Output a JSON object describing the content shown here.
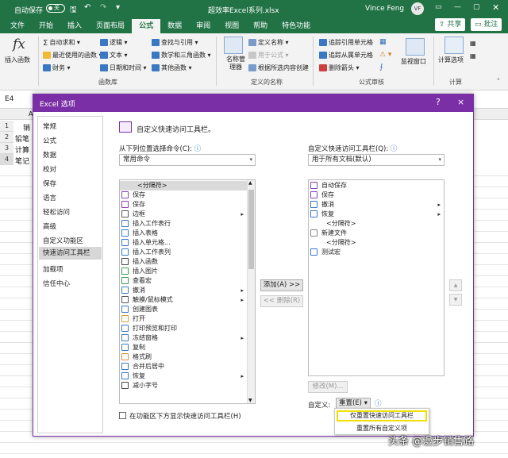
{
  "titlebar": {
    "autosave_label": "自动保存",
    "toggle_state": "关",
    "file_title": "超效率Excel系列.xlsx",
    "username": "Vince Feng",
    "user_initials": "VF"
  },
  "menu_tabs": [
    "文件",
    "开始",
    "插入",
    "页面布局",
    "公式",
    "数据",
    "审阅",
    "视图",
    "帮助",
    "特色功能"
  ],
  "share_label": "共享",
  "comment_label": "批注",
  "ribbon": {
    "insert_function": "插入函数",
    "autosum": "自动求和",
    "recent": "最近使用的函数",
    "financial": "财务",
    "logical": "逻辑",
    "text": "文本",
    "datetime": "日期和时间",
    "lookup": "查找与引用",
    "math": "数学和三角函数",
    "more": "其他函数",
    "function_library": "函数库",
    "name_manager": "名称管理器",
    "define_name": "定义名称",
    "use_in_formula": "用于公式",
    "create_from_selection": "根据所选内容创建",
    "defined_names": "定义的名称",
    "trace_precedents": "追踪引用单元格",
    "trace_dependents": "追踪从属单元格",
    "remove_arrows": "删除箭头",
    "formula_auditing": "公式审核",
    "watch_window": "监视窗口",
    "calc_options": "计算选项",
    "calculation": "计算"
  },
  "name_box": "E4",
  "sheet": {
    "rows": [
      "1",
      "2",
      "3",
      "4"
    ],
    "cells": [
      "销",
      "铅笔",
      "计算",
      "笔记"
    ],
    "col_a": "A"
  },
  "dialog": {
    "title": "Excel 选项",
    "help": "?",
    "close": "×",
    "nav": [
      "常规",
      "公式",
      "数据",
      "校对",
      "保存",
      "语言",
      "轻松访问",
      "高级",
      "自定义功能区",
      "快速访问工具栏",
      "加载项",
      "信任中心"
    ],
    "heading": "自定义快速访问工具栏。",
    "choose_label": "从下列位置选择命令(C):",
    "choose_value": "常用命令",
    "customize_label": "自定义快速访问工具栏(Q):",
    "customize_value": "用于所有文档(默认)",
    "commands": [
      {
        "label": "<分隔符>",
        "icon": "",
        "sub": false
      },
      {
        "label": "保存",
        "icon": "save",
        "sub": false
      },
      {
        "label": "保存",
        "icon": "save",
        "sub": false
      },
      {
        "label": "边框",
        "icon": "border",
        "sub": true
      },
      {
        "label": "插入工作表行",
        "icon": "insert-row",
        "sub": false
      },
      {
        "label": "插入表格",
        "icon": "table",
        "sub": false
      },
      {
        "label": "插入单元格...",
        "icon": "cell",
        "sub": false
      },
      {
        "label": "插入工作表列",
        "icon": "insert-col",
        "sub": false
      },
      {
        "label": "插入函数",
        "icon": "fx",
        "sub": false
      },
      {
        "label": "插入图片",
        "icon": "picture",
        "sub": false
      },
      {
        "label": "查看宏",
        "icon": "macro",
        "sub": false
      },
      {
        "label": "撤消",
        "icon": "undo",
        "sub": true
      },
      {
        "label": "触摸/鼠标模式",
        "icon": "touch",
        "sub": true
      },
      {
        "label": "创建图表",
        "icon": "chart",
        "sub": false
      },
      {
        "label": "打开",
        "icon": "open",
        "sub": false
      },
      {
        "label": "打印预览和打印",
        "icon": "print",
        "sub": false
      },
      {
        "label": "冻结窗格",
        "icon": "freeze",
        "sub": true
      },
      {
        "label": "复制",
        "icon": "copy",
        "sub": false
      },
      {
        "label": "格式刷",
        "icon": "brush",
        "sub": false
      },
      {
        "label": "合并后居中",
        "icon": "merge",
        "sub": false
      },
      {
        "label": "恢复",
        "icon": "redo",
        "sub": true
      },
      {
        "label": "减小字号",
        "icon": "font-small",
        "sub": false
      }
    ],
    "qat_items": [
      {
        "label": "自动保存",
        "icon": "autosave",
        "sub": false
      },
      {
        "label": "保存",
        "icon": "save",
        "sub": false
      },
      {
        "label": "撤消",
        "icon": "undo",
        "sub": true
      },
      {
        "label": "恢复",
        "icon": "redo",
        "sub": true
      },
      {
        "label": "<分隔符>",
        "icon": "",
        "sub": false
      },
      {
        "label": "新建文件",
        "icon": "new",
        "sub": false
      },
      {
        "label": "<分隔符>",
        "icon": "",
        "sub": false
      },
      {
        "label": "测试宏",
        "icon": "macro-test",
        "sub": false
      }
    ],
    "add_button": "添加(A) >>",
    "remove_button": "<< 删除(R)",
    "modify_button": "修改(M)...",
    "custom_label": "自定义:",
    "reset_button": "重置(E) ▾",
    "checkbox_label": "在功能区下方显示快速访问工具栏(H)",
    "reset_menu": [
      "仅重置快速访问工具栏",
      "重置所有自定义项"
    ]
  },
  "watermark": "头条 @漫步销售路",
  "colors": {
    "excel_green": "#217346",
    "dialog_purple": "#7b2fa6",
    "highlight_yellow": "#f0e000"
  }
}
